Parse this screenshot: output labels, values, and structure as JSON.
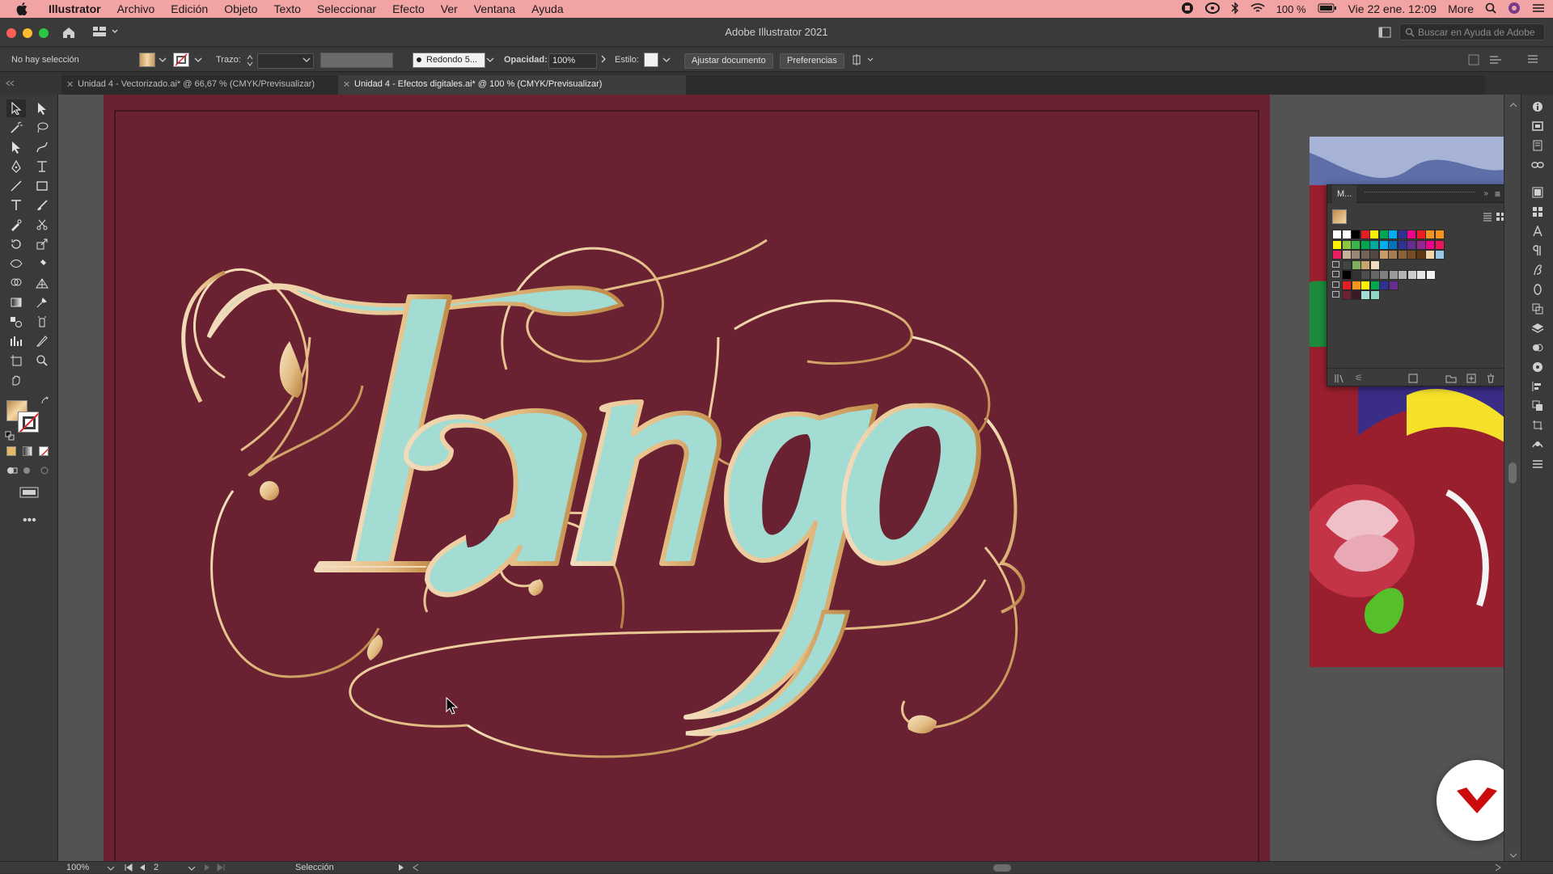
{
  "menubar": {
    "app": "Illustrator",
    "items": [
      "Archivo",
      "Edición",
      "Objeto",
      "Texto",
      "Seleccionar",
      "Efecto",
      "Ver",
      "Ventana",
      "Ayuda"
    ],
    "battery": "100 %",
    "datetime": "Vie 22 ene. 12:09",
    "more": "More"
  },
  "window": {
    "title": "Adobe Illustrator 2021",
    "search_placeholder": "Buscar en Ayuda de Adobe"
  },
  "control_bar": {
    "selection_status": "No hay selección",
    "stroke_label": "Trazo:",
    "brush": "Redondo 5...",
    "opacity_label": "Opacidad:",
    "opacity_value": "100%",
    "style_label": "Estilo:",
    "adjust_button": "Ajustar documento",
    "prefs_button": "Preferencias"
  },
  "tabs": [
    {
      "label": "Unidad 4 - Vectorizado.ai* @ 66,67 % (CMYK/Previsualizar)",
      "active": false
    },
    {
      "label": "Unidad 4 - Efectos digitales.ai* @ 100 % (CMYK/Previsualizar)",
      "active": true
    }
  ],
  "swatches_panel": {
    "tab_label": "M..."
  },
  "artwork": {
    "word": "Tango"
  },
  "status_bar": {
    "zoom": "100%",
    "artboard": "2",
    "tool": "Selección"
  },
  "colors": {
    "artboard": "#6a2131",
    "mint": "#a3dcd2",
    "cream": "#f2dcbc",
    "gold": "#c28b4a",
    "menubar": "#f2a3a3"
  }
}
